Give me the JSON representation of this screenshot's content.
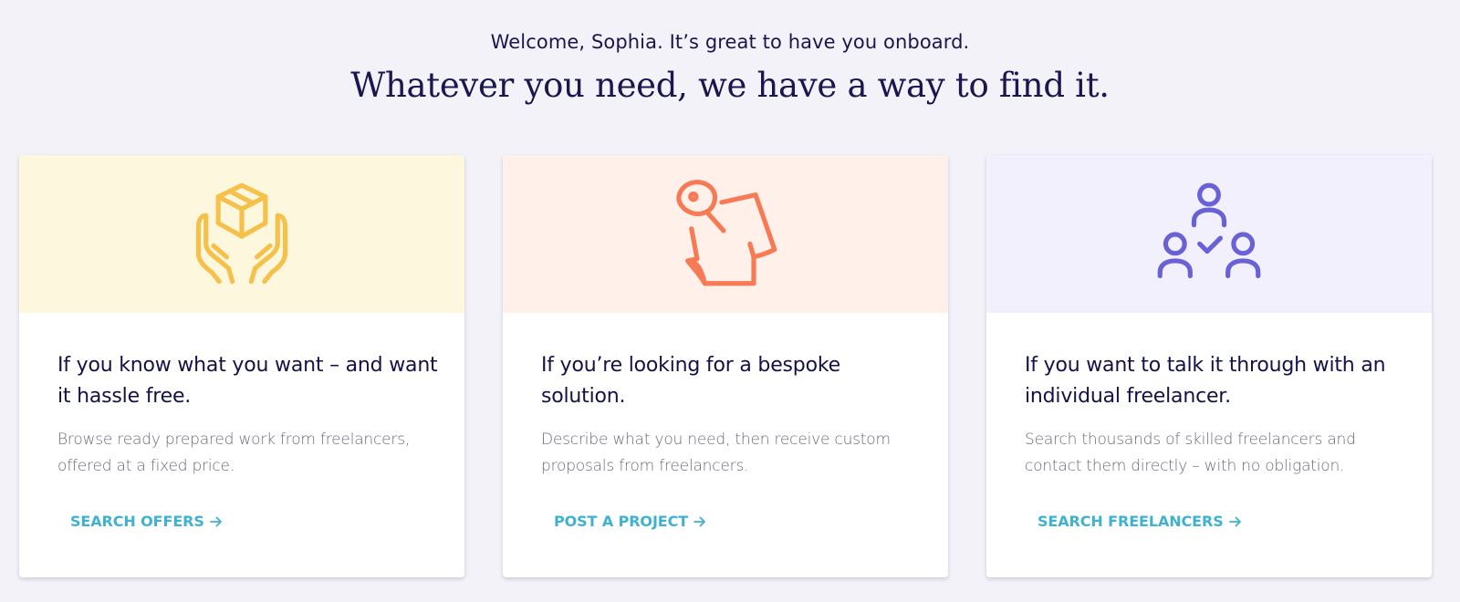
{
  "header": {
    "welcome": "Welcome, Sophia. It’s great to have you onboard.",
    "headline": "Whatever you need, we have a way to find it."
  },
  "colors": {
    "accent_link": "#3fb2cf",
    "text_dark": "#14114a",
    "text_muted": "#6b6880",
    "card1_bg": "#fdf7dd",
    "card1_icon": "#f5c14a",
    "card2_bg": "#fff1ea",
    "card2_icon": "#f77a55",
    "card3_bg": "#f1f0fc",
    "card3_icon": "#6a61d6"
  },
  "cards": [
    {
      "icon": "box-in-hands-icon",
      "title": "If you know what you want – and want it hassle free.",
      "description": "Browse ready prepared work from freelancers, offered at a fixed price.",
      "link_label": "SEARCH OFFERS"
    },
    {
      "icon": "pinned-note-icon",
      "title": "If you’re looking for a bespoke solution.",
      "description": "Describe what you need, then receive custom proposals from freelancers.",
      "link_label": "POST A PROJECT"
    },
    {
      "icon": "team-people-icon",
      "title": "If you want to talk it through with an individual freelancer.",
      "description": "Search thousands of skilled freelancers and contact them directly – with no obligation.",
      "link_label": "SEARCH FREELANCERS"
    }
  ]
}
